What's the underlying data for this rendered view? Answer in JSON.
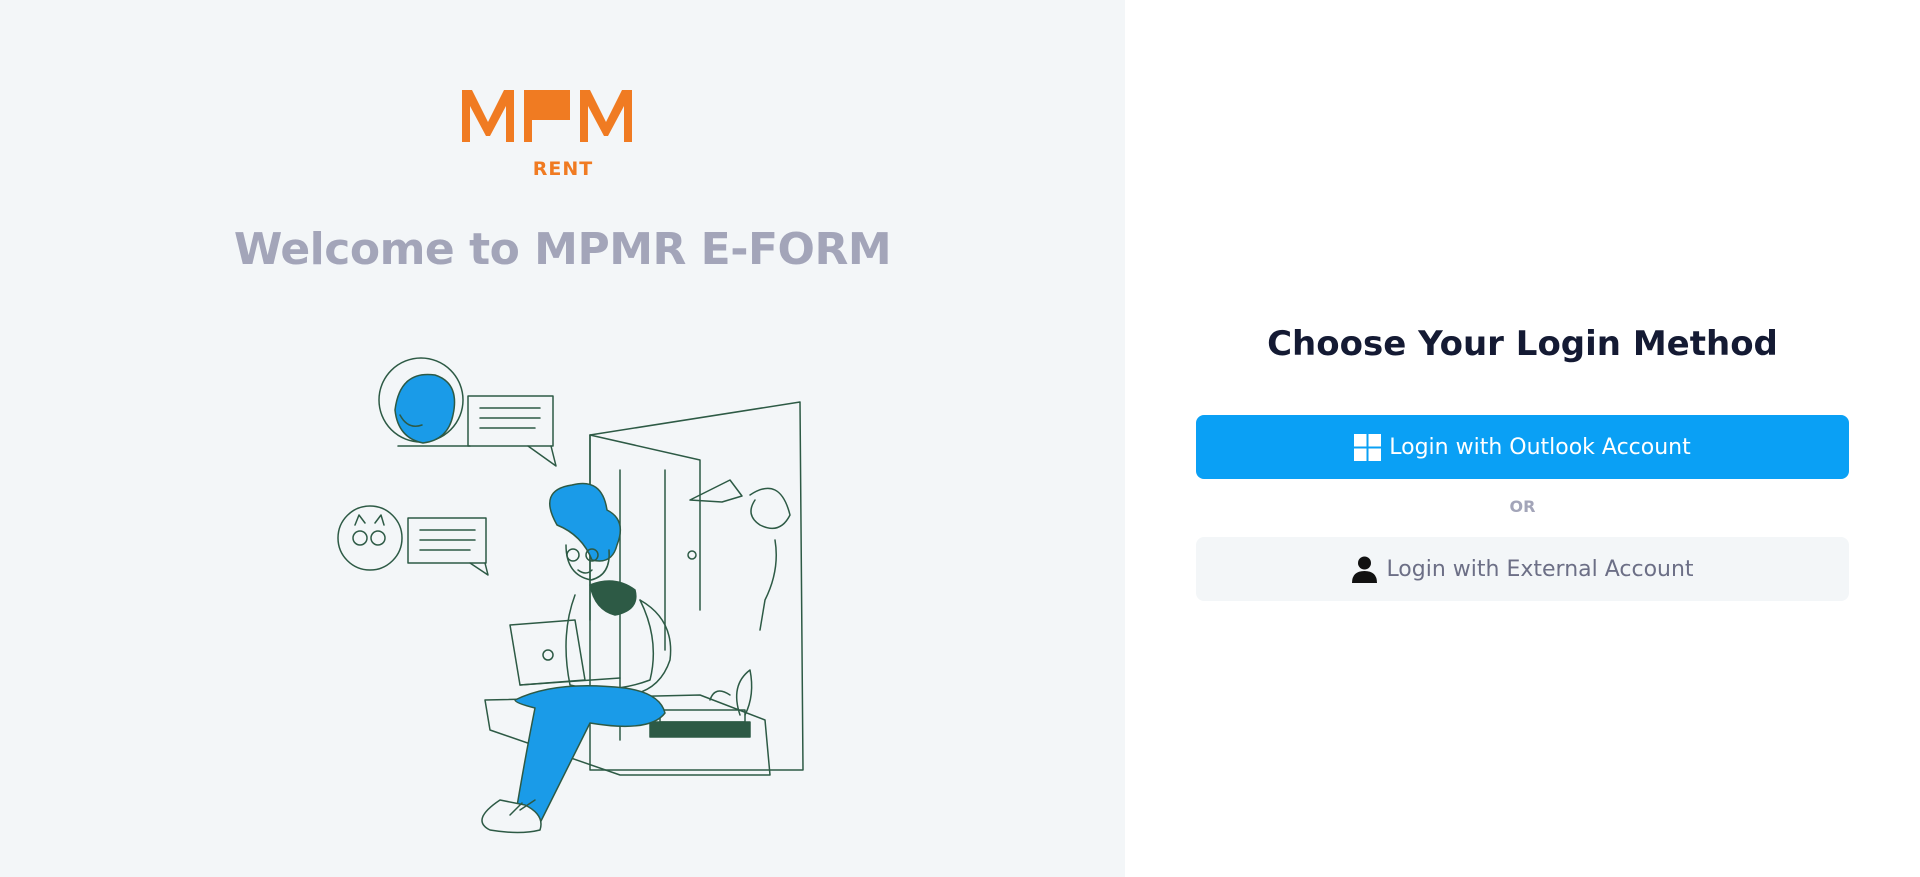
{
  "brand": {
    "logo_name": "MPM",
    "logo_sub": "RENT",
    "color": "#f07b22"
  },
  "welcome": {
    "title": "Welcome to MPMR E-FORM"
  },
  "illustration": {
    "icon": "person-with-laptop-illustration"
  },
  "login": {
    "title": "Choose Your Login Method",
    "outlook_label": "Login with Outlook Account",
    "outlook_icon": "windows-icon",
    "or_label": "OR",
    "external_label": "Login with External Account",
    "external_icon": "user-icon"
  },
  "colors": {
    "primary": "#0aa0f5",
    "left_bg": "#f3f6f8",
    "title": "#141a33",
    "muted": "#a3a5b9"
  }
}
